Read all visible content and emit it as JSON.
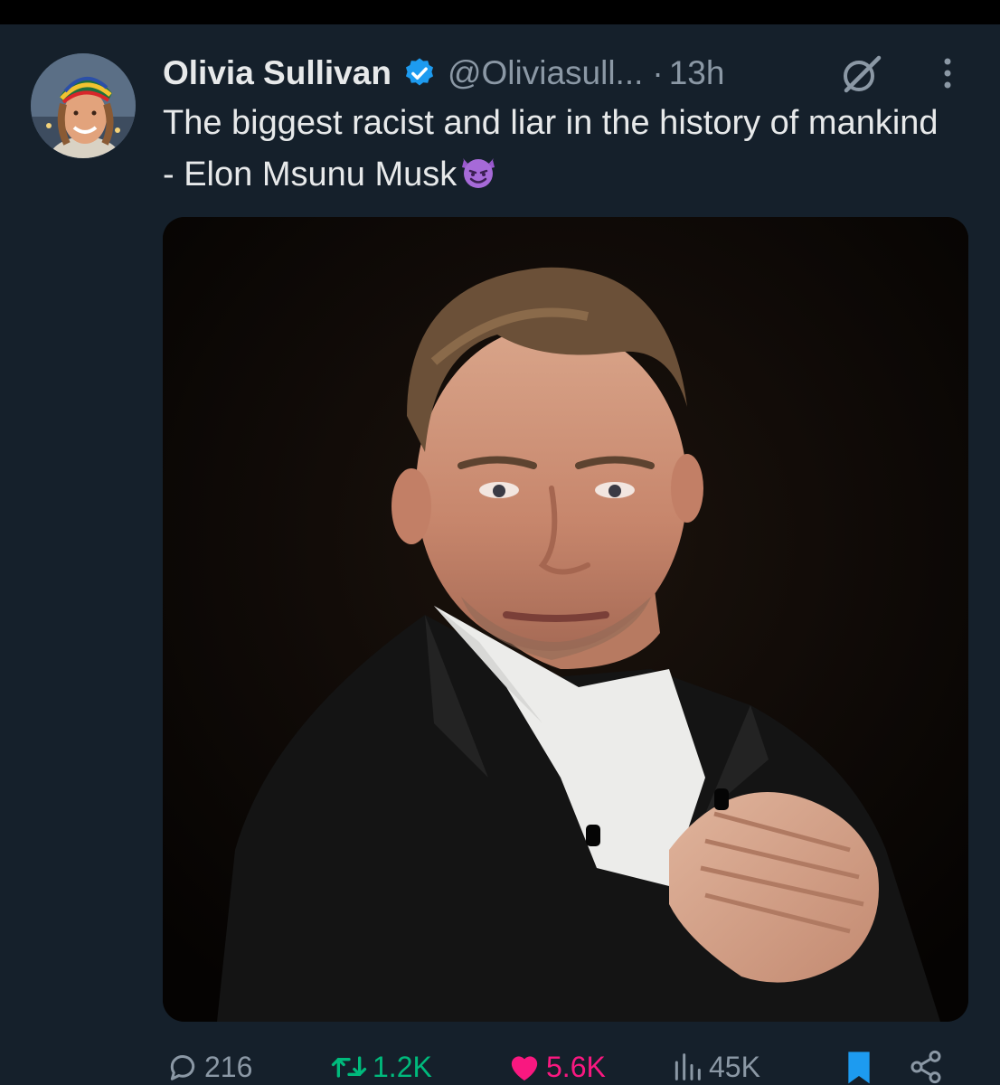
{
  "tweet": {
    "author_name": "Olivia Sullivan",
    "handle": "@Oliviasull...",
    "separator": "·",
    "time": "13h",
    "text": "The biggest racist and liar in the history of mankind - Elon Msunu Musk",
    "emoji_icon": "smiling-devil-emoji"
  },
  "icons": {
    "avatar": "avatar",
    "verified": "verified-badge-icon",
    "grok": "grok-icon",
    "more": "more-vertical-icon",
    "reply": "reply-icon",
    "retweet": "retweet-icon",
    "like": "heart-icon",
    "views": "views-icon",
    "bookmark": "bookmark-icon",
    "share": "share-icon"
  },
  "actions": {
    "replies": "216",
    "retweets": "1.2K",
    "likes": "5.6K",
    "views": "45K"
  },
  "colors": {
    "background": "#15202b",
    "text": "#e7e9ea",
    "muted": "#8b98a5",
    "verified": "#1d9bf0",
    "retweet": "#00ba7c",
    "like": "#f91880",
    "bookmark": "#1d9bf0"
  }
}
